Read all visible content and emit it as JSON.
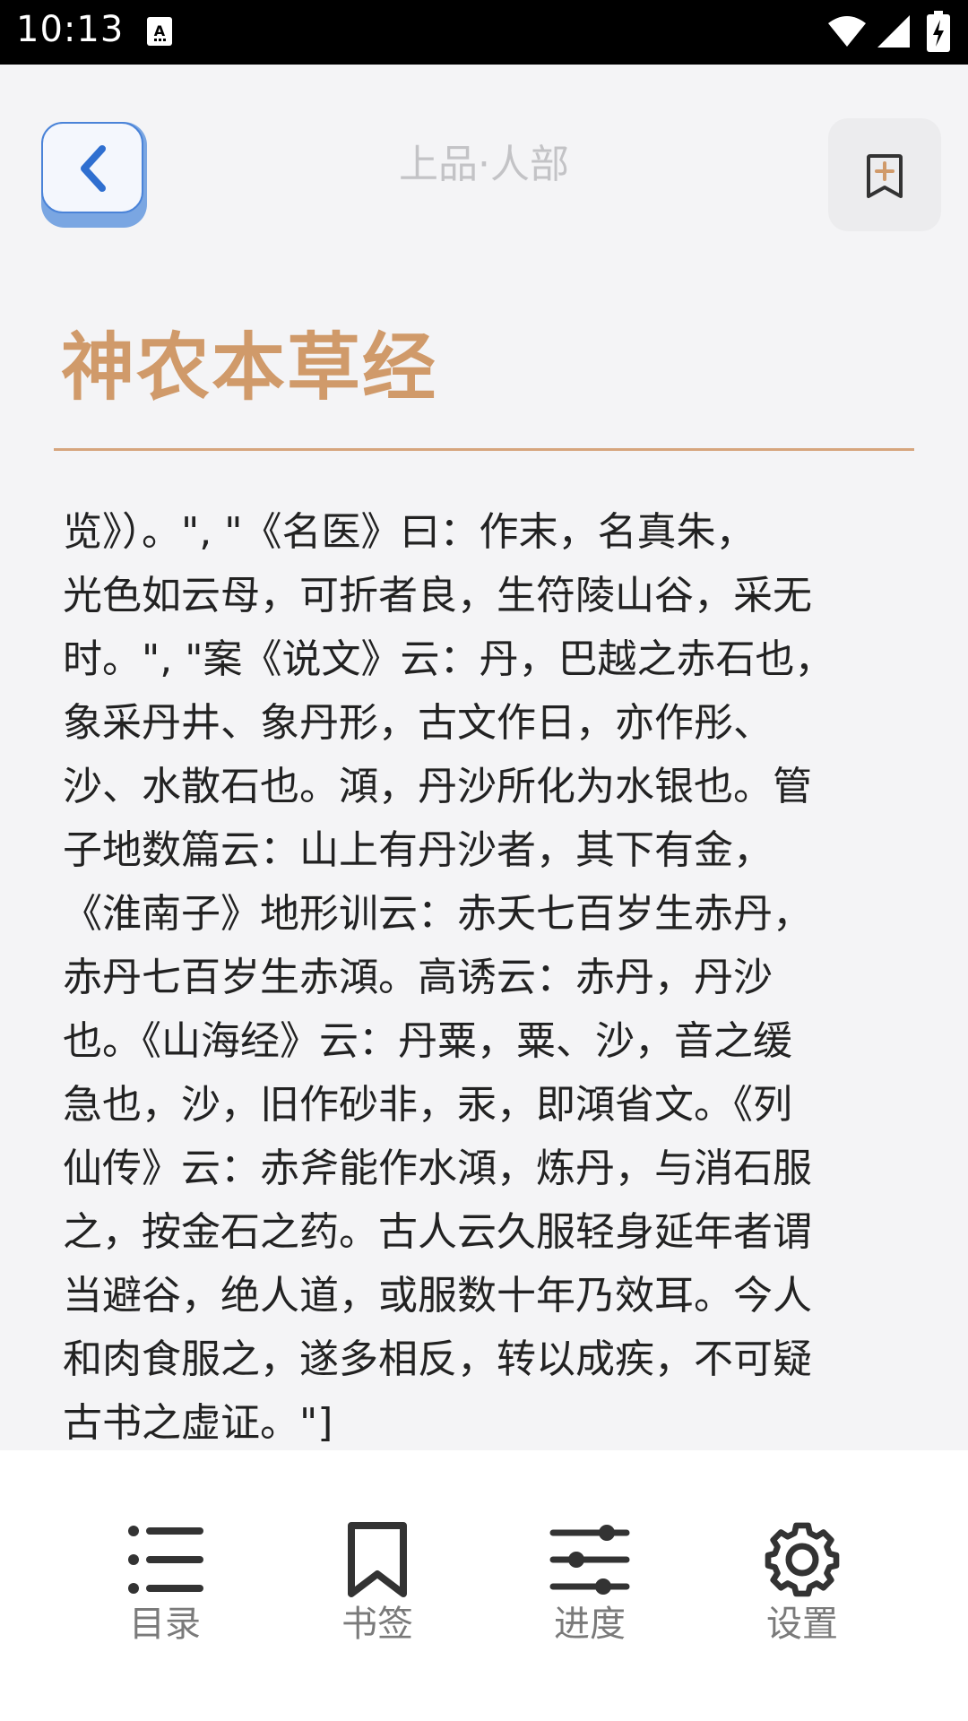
{
  "status_bar": {
    "time": "10:13"
  },
  "header": {
    "chapter_title": "上品·人部",
    "back_icon": "chevron-left-icon",
    "add_bookmark_icon": "bookmark-plus-icon"
  },
  "book": {
    "title": "神农本草经"
  },
  "content": {
    "lines": [
      "览》）。\", \"《名医》曰：作末，名真朱，",
      "光色如云母，可折者良，生符陵山谷，采无",
      "时。\", \"案《说文》云：丹，巴越之赤石也，",
      "象采丹井、象丹形，古文作日，亦作彤、",
      "沙、水散石也。澒，丹沙所化为水银也。管",
      "子地数篇云：山上有丹沙者，其下有金，",
      "《淮南子》地形训云：赤夭七百岁生赤丹，",
      "赤丹七百岁生赤澒。高诱云：赤丹，丹沙",
      "也。《山海经》云：丹粟，粟、沙，音之缓",
      "急也，沙，旧作砂非，汞，即澒省文。《列",
      "仙传》云：赤斧能作水澒，炼丹，与消石服",
      "之，按金石之药。古人云久服轻身延年者谓",
      "当避谷，绝人道，或服数十年乃效耳。今人",
      "和肉食服之，遂多相反，转以成疾，不可疑",
      "古书之虚证。\"]"
    ]
  },
  "bottom_nav": {
    "items": [
      {
        "label": "目录",
        "icon": "list-icon"
      },
      {
        "label": "书签",
        "icon": "bookmark-icon"
      },
      {
        "label": "进度",
        "icon": "sliders-icon"
      },
      {
        "label": "设置",
        "icon": "gear-icon"
      }
    ]
  },
  "colors": {
    "accent": "#d09a6a",
    "back_button": "#4a83d8",
    "background": "#f4f4f6"
  }
}
